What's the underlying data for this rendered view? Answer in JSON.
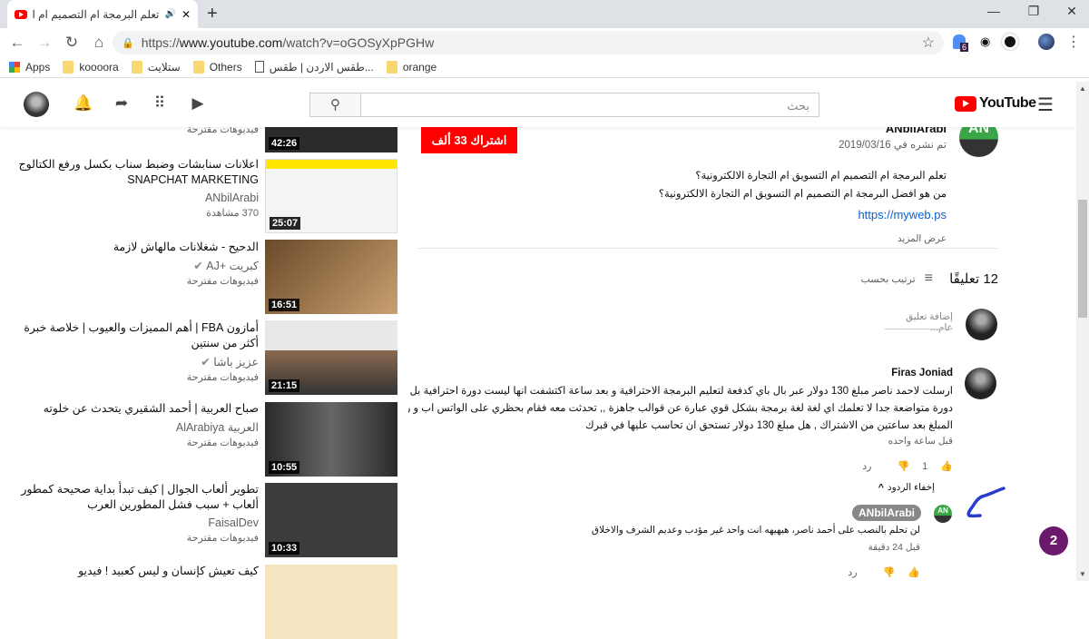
{
  "browser": {
    "tab_title": "تعلم البرمجة ام التصميم ام التس",
    "url_prefix": "https://",
    "url_host": "www.youtube.com",
    "url_path": "/watch?v=oGOSyXpPGHw",
    "extension_badge": "6",
    "bookmarks": [
      "Apps",
      "koooora",
      "ستلايت",
      "Others",
      "طقس الاردن | طقس...",
      "orange"
    ]
  },
  "header": {
    "logo": "YouTube",
    "search_placeholder": "بحث"
  },
  "sidebar": {
    "top_partial_meta": "فيديوهات مقترحة",
    "items": [
      {
        "title": "اعلانات سنابشات وضبط سناب بكسل ورفع الكتالوج SNAPCHAT MARKETING",
        "channel": "ANbilArabi",
        "meta": "370 مشاهدة",
        "duration": "25:07"
      },
      {
        "title": "الدحيح - شغلانات مالهاش لازمة",
        "channel": "كبريت +AJ",
        "meta": "فيديوهات مقترحة",
        "duration": "16:51",
        "verified": true
      },
      {
        "title": "أمازون FBA | أهم المميزات والعيوب | خلاصة خبرة أكثر من سنتين",
        "channel": "عزيز باشا",
        "meta": "فيديوهات مقترحة",
        "duration": "21:15",
        "verified": true
      },
      {
        "title": "صباح العربية | أحمد الشقيري يتحدث عن خلوته",
        "channel": "العربية AlArabiya",
        "meta": "فيديوهات مقترحة",
        "duration": "10:55"
      },
      {
        "title": "تطوير ألعاب الجوال | كيف تبدأ بداية صحيحة كمطور ألعاب + سبب فشل المطورين العرب",
        "channel": "FaisalDev",
        "meta": "فيديوهات مقترحة",
        "duration": "10:33"
      },
      {
        "title": "كيف تعيش كإنسان و ليس كعبيد ! فيديو",
        "channel": "",
        "meta": "",
        "duration": ""
      }
    ],
    "first_duration": "42:26"
  },
  "video": {
    "channel": "ANbilArabi",
    "published": "تم نشره في 2019/03/16",
    "subscribe": "اشتراك  33 ألف",
    "description": [
      "تعلم البرمجة ام التصميم ام التسويق ام التجارة الالكترونية؟",
      "من هو افضل البرمجة ام التصميم ام التسويق ام التجارة الالكترونية؟"
    ],
    "link": "https://myweb.ps",
    "show_more": "عرض المزيد"
  },
  "comments": {
    "count": "12 تعليقًا",
    "sort": "ترتيب بحسب",
    "add_placeholder": "إضافة تعليق عام...",
    "items": [
      {
        "author": "Firas Joniad",
        "lines": [
          "ارسلت لاحمد ناصر مبلغ 130 دولار عبر بال باي كدفعة لتعليم البرمجة الاحترافية و بعد ساعة اكتشفت انها ليست دورة احترافية بل عبارة عن",
          "دورة متواضعة جدا لا تعلمك اي لغة لغة برمجة بشكل قوي عبارة عن قوالب جاهزة ,, تحدثت معه فقام بحظري على الواتس اب و رفض اعادة",
          "المبلغ بعد ساعتين من الاشتراك , هل مبلغ 130 دولار تستحق ان تحاسب عليها في قبرك"
        ],
        "time": "قبل ساعة واحده",
        "likes": "1",
        "reply": "رد"
      }
    ],
    "hide_replies": "إخفاء الردود",
    "reply": {
      "author": "ANbilArabi",
      "text": "لن تحلم بالنصب على أحمد ناصر، هيهيهه انت واحد غير مؤدب وعديم الشرف والاخلاق",
      "time": "قبل 24 دقيقة",
      "reply": "رد"
    }
  },
  "notification_badge": "2"
}
